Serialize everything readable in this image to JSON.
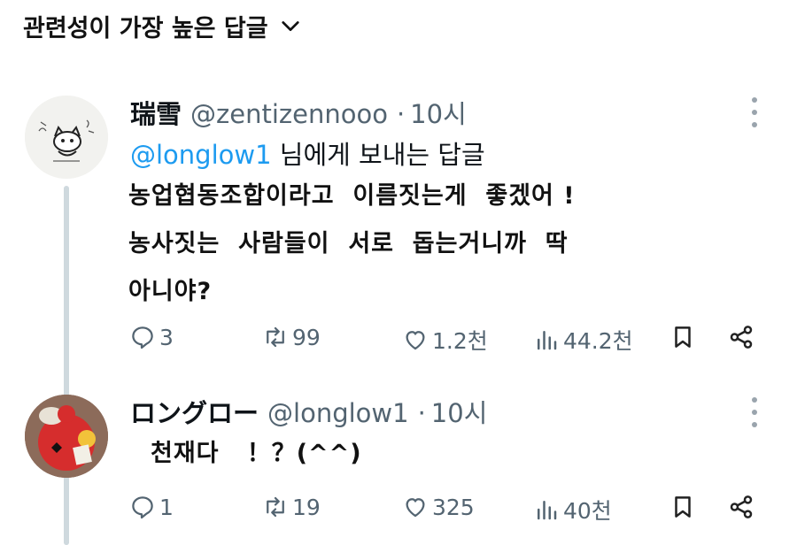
{
  "sort": {
    "label": "관련성이 가장 높은 답글"
  },
  "tweets": [
    {
      "name": "瑞雪",
      "handle": "@zentizennooo",
      "dot": "·",
      "time": "10시",
      "reply_to": {
        "mention": "@longlow1",
        "suffix": " 님에게 보내는 답글"
      },
      "lines": [
        "농업협동조합이라고  이름짓는게  좋겠어 !",
        "농사짓는  사람들이  서로  돕는거니까  딱",
        "아니야?"
      ],
      "stats": {
        "replies": "3",
        "reposts": "99",
        "likes": "1.2천",
        "views": "44.2천"
      }
    },
    {
      "name": "ロングロー",
      "handle": "@longlow1",
      "dot": "·",
      "time": "10시",
      "lines": [
        "천재다   ！？(^^)"
      ],
      "stats": {
        "replies": "1",
        "reposts": "19",
        "likes": "325",
        "views": "40천"
      }
    }
  ]
}
